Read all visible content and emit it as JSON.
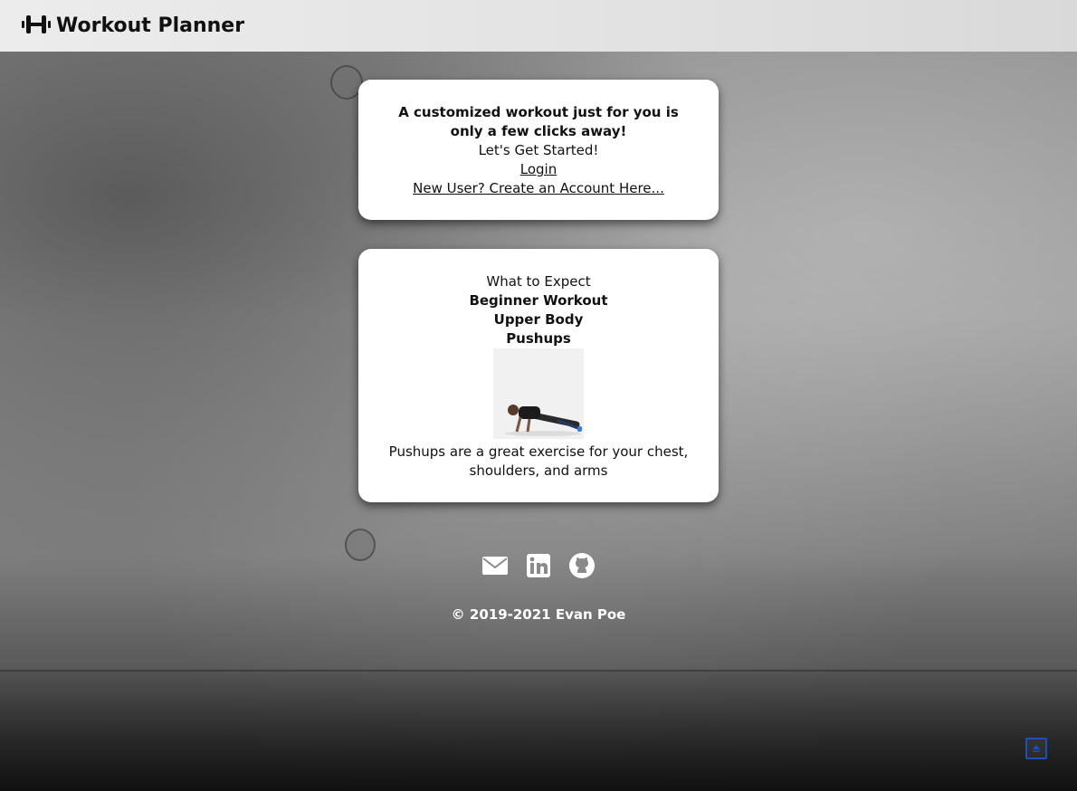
{
  "header": {
    "title": "Workout Planner",
    "logo_icon": "dumbbell-icon"
  },
  "intro_card": {
    "headline": "A customized workout just for you is only a few clicks away!",
    "subheading": "Let's Get Started!",
    "login_link": "Login",
    "signup_link": "New User? Create an Account Here..."
  },
  "preview_card": {
    "section_label": "What to Expect",
    "workout_level": "Beginner Workout",
    "body_area": "Upper Body",
    "exercise": "Pushups",
    "description": "Pushups are a great exercise for your chest, shoulders, and arms"
  },
  "footer": {
    "social_icons": [
      "mail-icon",
      "linkedin-icon",
      "github-icon"
    ],
    "copyright": "© 2019-2021 Evan Poe"
  },
  "colors": {
    "scroll_top_border": "#1c4fb8"
  }
}
